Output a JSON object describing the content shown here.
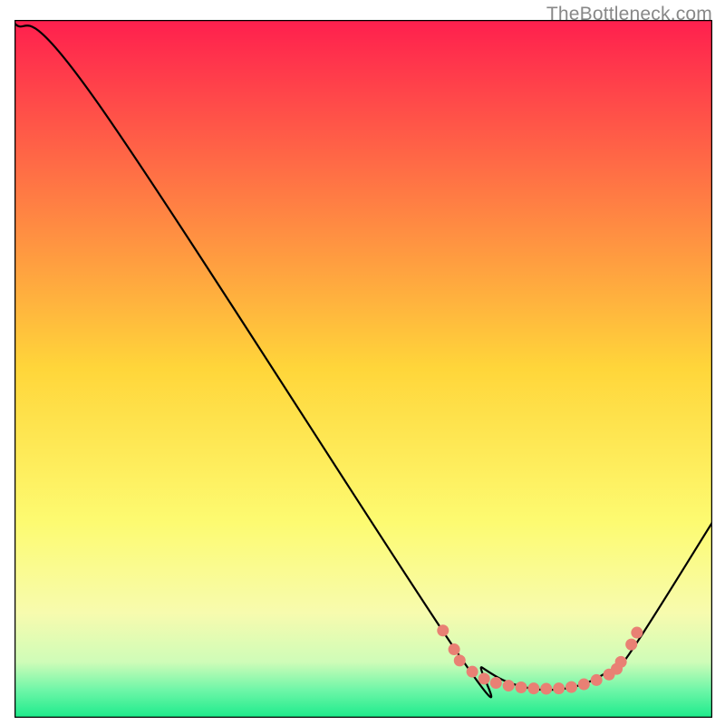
{
  "watermark": "TheBottleneck.com",
  "chart_data": {
    "type": "line",
    "title": "",
    "xlabel": "",
    "ylabel": "",
    "xlim": [
      0,
      100
    ],
    "ylim": [
      0,
      100
    ],
    "grid": false,
    "series": [
      {
        "name": "curve",
        "color": "#000000",
        "x": [
          0,
          12,
          63,
          67,
          70,
          73,
          76,
          79,
          82,
          85,
          88,
          100
        ],
        "y": [
          99.5,
          88,
          10,
          7.2,
          5.4,
          4.4,
          4.0,
          4.2,
          5.0,
          6.6,
          9.0,
          28
        ]
      },
      {
        "name": "marker-cluster",
        "color": "#E98074",
        "type": "scatter",
        "x": [
          61.4,
          63.0,
          63.8,
          65.6,
          67.3,
          69.0,
          70.8,
          72.6,
          74.4,
          76.2,
          78.0,
          79.8,
          81.6,
          83.4,
          85.2,
          86.3,
          86.9,
          88.4,
          89.2
        ],
        "y": [
          12.5,
          9.8,
          8.2,
          6.6,
          5.6,
          5.0,
          4.6,
          4.35,
          4.2,
          4.15,
          4.2,
          4.4,
          4.8,
          5.4,
          6.2,
          7.0,
          8.0,
          10.5,
          12.2
        ]
      }
    ],
    "background": {
      "type": "gradient",
      "direction": "vertical",
      "stops": [
        {
          "offset": 0.0,
          "color": "#FF1F4E"
        },
        {
          "offset": 0.5,
          "color": "#FFD63A"
        },
        {
          "offset": 0.72,
          "color": "#FDFB71"
        },
        {
          "offset": 0.85,
          "color": "#F7FBAE"
        },
        {
          "offset": 0.92,
          "color": "#CFFCB8"
        },
        {
          "offset": 0.96,
          "color": "#6FF6A8"
        },
        {
          "offset": 1.0,
          "color": "#1CEB8B"
        }
      ]
    },
    "border_color": "#000000"
  }
}
